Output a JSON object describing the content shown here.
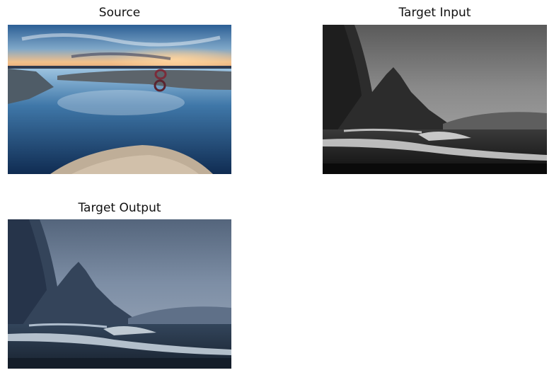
{
  "panels": [
    {
      "title": "Source",
      "image": "sunset-lake-rocks-reflection-with-ring-marks",
      "palette": [
        "#2c5a8c",
        "#f0b27a",
        "#1b3f6b",
        "#c9b9a3"
      ]
    },
    {
      "title": "Target Input",
      "image": "grayscale-mountain-coast-with-crashing-waves",
      "palette": [
        "#6a6a6a",
        "#2a2a2a",
        "#d9d9d9",
        "#101010"
      ]
    },
    {
      "title": "Target Output",
      "image": "blue-toned-mountain-coast-with-crashing-waves",
      "palette": [
        "#6d7f96",
        "#2f3d50",
        "#cfd9e4",
        "#1b2635"
      ]
    }
  ]
}
